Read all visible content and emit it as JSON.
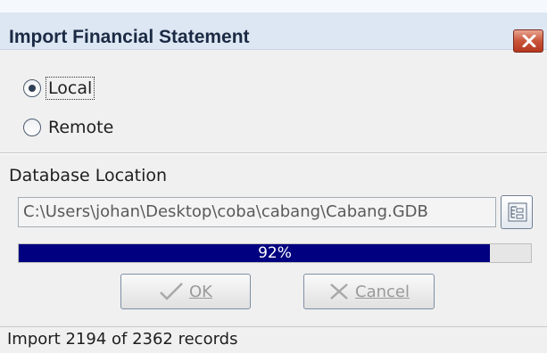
{
  "window": {
    "title": "Import Financial Statement",
    "close_icon": "close-icon"
  },
  "source": {
    "options": [
      {
        "label": "Local",
        "selected": true
      },
      {
        "label": "Remote",
        "selected": false
      }
    ]
  },
  "database": {
    "label": "Database Location",
    "path": "C:\\Users\\johan\\Desktop\\coba\\cabang\\Cabang.GDB",
    "browse_icon": "browse-folder-icon"
  },
  "progress": {
    "value": 0.92,
    "text": "92%",
    "fill_color": "#000080"
  },
  "buttons": {
    "ok": {
      "label": "OK",
      "icon": "checkmark-icon",
      "enabled": false
    },
    "cancel": {
      "label": "Cancel",
      "icon": "x-icon",
      "enabled": false
    }
  },
  "status": {
    "text": "Import 2194 of 2362 records"
  },
  "colors": {
    "titlebar": "#dde7f3",
    "close": "#c8553a",
    "background": "#f0f0f0"
  }
}
